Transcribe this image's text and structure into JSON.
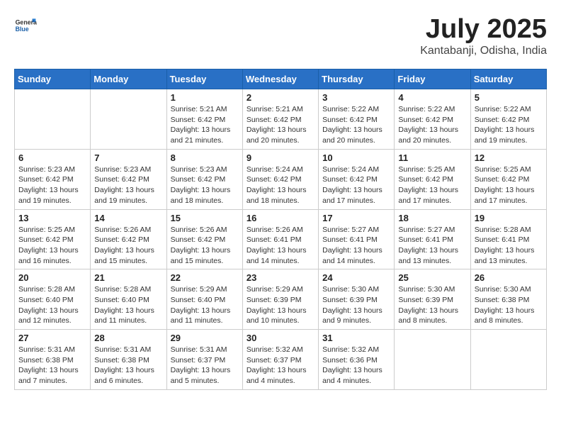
{
  "header": {
    "logo_general": "General",
    "logo_blue": "Blue",
    "month": "July 2025",
    "location": "Kantabanji, Odisha, India"
  },
  "weekdays": [
    "Sunday",
    "Monday",
    "Tuesday",
    "Wednesday",
    "Thursday",
    "Friday",
    "Saturday"
  ],
  "weeks": [
    [
      {
        "day": "",
        "sunrise": "",
        "sunset": "",
        "daylight": "",
        "empty": true
      },
      {
        "day": "",
        "sunrise": "",
        "sunset": "",
        "daylight": "",
        "empty": true
      },
      {
        "day": "1",
        "sunrise": "Sunrise: 5:21 AM",
        "sunset": "Sunset: 6:42 PM",
        "daylight": "Daylight: 13 hours and 21 minutes."
      },
      {
        "day": "2",
        "sunrise": "Sunrise: 5:21 AM",
        "sunset": "Sunset: 6:42 PM",
        "daylight": "Daylight: 13 hours and 20 minutes."
      },
      {
        "day": "3",
        "sunrise": "Sunrise: 5:22 AM",
        "sunset": "Sunset: 6:42 PM",
        "daylight": "Daylight: 13 hours and 20 minutes."
      },
      {
        "day": "4",
        "sunrise": "Sunrise: 5:22 AM",
        "sunset": "Sunset: 6:42 PM",
        "daylight": "Daylight: 13 hours and 20 minutes."
      },
      {
        "day": "5",
        "sunrise": "Sunrise: 5:22 AM",
        "sunset": "Sunset: 6:42 PM",
        "daylight": "Daylight: 13 hours and 19 minutes."
      }
    ],
    [
      {
        "day": "6",
        "sunrise": "Sunrise: 5:23 AM",
        "sunset": "Sunset: 6:42 PM",
        "daylight": "Daylight: 13 hours and 19 minutes."
      },
      {
        "day": "7",
        "sunrise": "Sunrise: 5:23 AM",
        "sunset": "Sunset: 6:42 PM",
        "daylight": "Daylight: 13 hours and 19 minutes."
      },
      {
        "day": "8",
        "sunrise": "Sunrise: 5:23 AM",
        "sunset": "Sunset: 6:42 PM",
        "daylight": "Daylight: 13 hours and 18 minutes."
      },
      {
        "day": "9",
        "sunrise": "Sunrise: 5:24 AM",
        "sunset": "Sunset: 6:42 PM",
        "daylight": "Daylight: 13 hours and 18 minutes."
      },
      {
        "day": "10",
        "sunrise": "Sunrise: 5:24 AM",
        "sunset": "Sunset: 6:42 PM",
        "daylight": "Daylight: 13 hours and 17 minutes."
      },
      {
        "day": "11",
        "sunrise": "Sunrise: 5:25 AM",
        "sunset": "Sunset: 6:42 PM",
        "daylight": "Daylight: 13 hours and 17 minutes."
      },
      {
        "day": "12",
        "sunrise": "Sunrise: 5:25 AM",
        "sunset": "Sunset: 6:42 PM",
        "daylight": "Daylight: 13 hours and 17 minutes."
      }
    ],
    [
      {
        "day": "13",
        "sunrise": "Sunrise: 5:25 AM",
        "sunset": "Sunset: 6:42 PM",
        "daylight": "Daylight: 13 hours and 16 minutes."
      },
      {
        "day": "14",
        "sunrise": "Sunrise: 5:26 AM",
        "sunset": "Sunset: 6:42 PM",
        "daylight": "Daylight: 13 hours and 15 minutes."
      },
      {
        "day": "15",
        "sunrise": "Sunrise: 5:26 AM",
        "sunset": "Sunset: 6:42 PM",
        "daylight": "Daylight: 13 hours and 15 minutes."
      },
      {
        "day": "16",
        "sunrise": "Sunrise: 5:26 AM",
        "sunset": "Sunset: 6:41 PM",
        "daylight": "Daylight: 13 hours and 14 minutes."
      },
      {
        "day": "17",
        "sunrise": "Sunrise: 5:27 AM",
        "sunset": "Sunset: 6:41 PM",
        "daylight": "Daylight: 13 hours and 14 minutes."
      },
      {
        "day": "18",
        "sunrise": "Sunrise: 5:27 AM",
        "sunset": "Sunset: 6:41 PM",
        "daylight": "Daylight: 13 hours and 13 minutes."
      },
      {
        "day": "19",
        "sunrise": "Sunrise: 5:28 AM",
        "sunset": "Sunset: 6:41 PM",
        "daylight": "Daylight: 13 hours and 13 minutes."
      }
    ],
    [
      {
        "day": "20",
        "sunrise": "Sunrise: 5:28 AM",
        "sunset": "Sunset: 6:40 PM",
        "daylight": "Daylight: 13 hours and 12 minutes."
      },
      {
        "day": "21",
        "sunrise": "Sunrise: 5:28 AM",
        "sunset": "Sunset: 6:40 PM",
        "daylight": "Daylight: 13 hours and 11 minutes."
      },
      {
        "day": "22",
        "sunrise": "Sunrise: 5:29 AM",
        "sunset": "Sunset: 6:40 PM",
        "daylight": "Daylight: 13 hours and 11 minutes."
      },
      {
        "day": "23",
        "sunrise": "Sunrise: 5:29 AM",
        "sunset": "Sunset: 6:39 PM",
        "daylight": "Daylight: 13 hours and 10 minutes."
      },
      {
        "day": "24",
        "sunrise": "Sunrise: 5:30 AM",
        "sunset": "Sunset: 6:39 PM",
        "daylight": "Daylight: 13 hours and 9 minutes."
      },
      {
        "day": "25",
        "sunrise": "Sunrise: 5:30 AM",
        "sunset": "Sunset: 6:39 PM",
        "daylight": "Daylight: 13 hours and 8 minutes."
      },
      {
        "day": "26",
        "sunrise": "Sunrise: 5:30 AM",
        "sunset": "Sunset: 6:38 PM",
        "daylight": "Daylight: 13 hours and 8 minutes."
      }
    ],
    [
      {
        "day": "27",
        "sunrise": "Sunrise: 5:31 AM",
        "sunset": "Sunset: 6:38 PM",
        "daylight": "Daylight: 13 hours and 7 minutes."
      },
      {
        "day": "28",
        "sunrise": "Sunrise: 5:31 AM",
        "sunset": "Sunset: 6:38 PM",
        "daylight": "Daylight: 13 hours and 6 minutes."
      },
      {
        "day": "29",
        "sunrise": "Sunrise: 5:31 AM",
        "sunset": "Sunset: 6:37 PM",
        "daylight": "Daylight: 13 hours and 5 minutes."
      },
      {
        "day": "30",
        "sunrise": "Sunrise: 5:32 AM",
        "sunset": "Sunset: 6:37 PM",
        "daylight": "Daylight: 13 hours and 4 minutes."
      },
      {
        "day": "31",
        "sunrise": "Sunrise: 5:32 AM",
        "sunset": "Sunset: 6:36 PM",
        "daylight": "Daylight: 13 hours and 4 minutes."
      },
      {
        "day": "",
        "sunrise": "",
        "sunset": "",
        "daylight": "",
        "empty": true
      },
      {
        "day": "",
        "sunrise": "",
        "sunset": "",
        "daylight": "",
        "empty": true
      }
    ]
  ]
}
